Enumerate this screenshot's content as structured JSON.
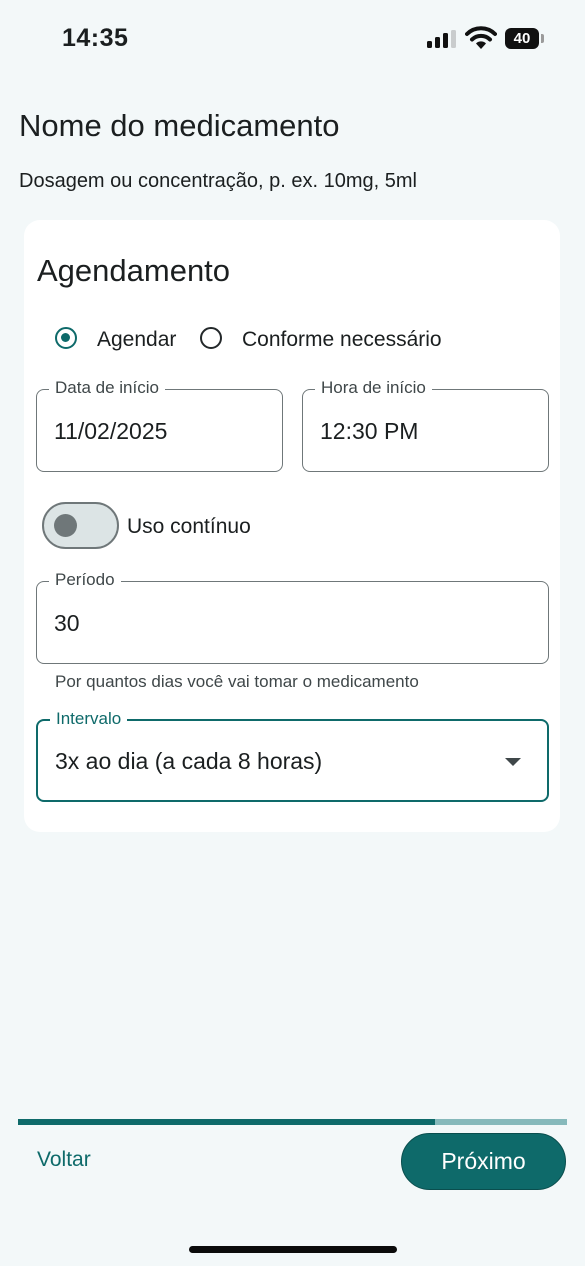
{
  "status_bar": {
    "time": "14:35",
    "battery": "40"
  },
  "medication": {
    "name": "Nome do medicamento",
    "dosage_hint": "Dosagem ou concentração, p. ex. 10mg, 5ml"
  },
  "schedule": {
    "title": "Agendamento",
    "options": [
      {
        "label": "Agendar",
        "selected": true
      },
      {
        "label": "Conforme necessário",
        "selected": false
      }
    ],
    "start_date": {
      "label": "Data de início",
      "value": "11/02/2025"
    },
    "start_time": {
      "label": "Hora de início",
      "value": "12:30 PM"
    },
    "continuous_use": {
      "label": "Uso contínuo",
      "on": false
    },
    "period": {
      "label": "Período",
      "value": "30",
      "helper": "Por quantos dias você vai tomar o medicamento"
    },
    "interval": {
      "label": "Intervalo",
      "value": "3x ao dia (a cada 8 horas)"
    }
  },
  "progress": {
    "fraction": 0.76
  },
  "footer": {
    "back_label": "Voltar",
    "next_label": "Próximo"
  },
  "colors": {
    "accent": "#0e6a6a",
    "background": "#f3f8f9"
  }
}
